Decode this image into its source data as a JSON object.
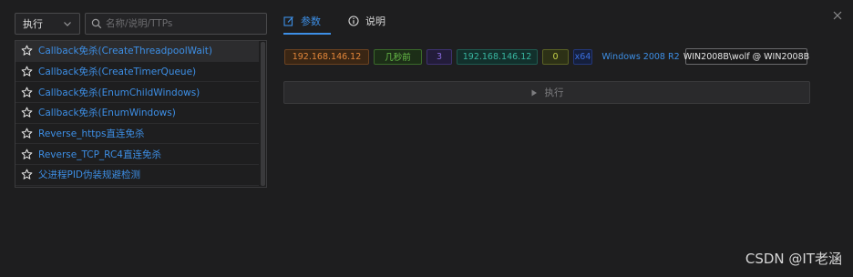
{
  "filter": {
    "selected": "执行"
  },
  "search": {
    "placeholder": "名称/说明/TTPs"
  },
  "list": {
    "items": [
      {
        "label": "Callback免杀(CreateThreadpoolWait)"
      },
      {
        "label": "Callback免杀(CreateTimerQueue)"
      },
      {
        "label": "Callback免杀(EnumChildWindows)"
      },
      {
        "label": "Callback免杀(EnumWindows)"
      },
      {
        "label": "Reverse_https直连免杀"
      },
      {
        "label": "Reverse_TCP_RC4直连免杀"
      },
      {
        "label": "父进程PID伪装规避检测"
      }
    ]
  },
  "tabs": [
    {
      "label": "参数",
      "icon": "edit-icon"
    },
    {
      "label": "说明",
      "icon": "info-icon"
    }
  ],
  "session": {
    "external_ip": "192.168.146.12",
    "last_seen": "几秒前",
    "count": "3",
    "internal_ip": "192.168.146.12",
    "zero": "0",
    "arch": "x64",
    "os": "Windows 2008 R2",
    "user": "WIN2008B\\wolf @ WIN2008B"
  },
  "run_button": {
    "label": "执行"
  },
  "watermark": "CSDN @IT老涵",
  "colors": {
    "accent": "#3d8fe6",
    "background": "#1e1e1f"
  }
}
